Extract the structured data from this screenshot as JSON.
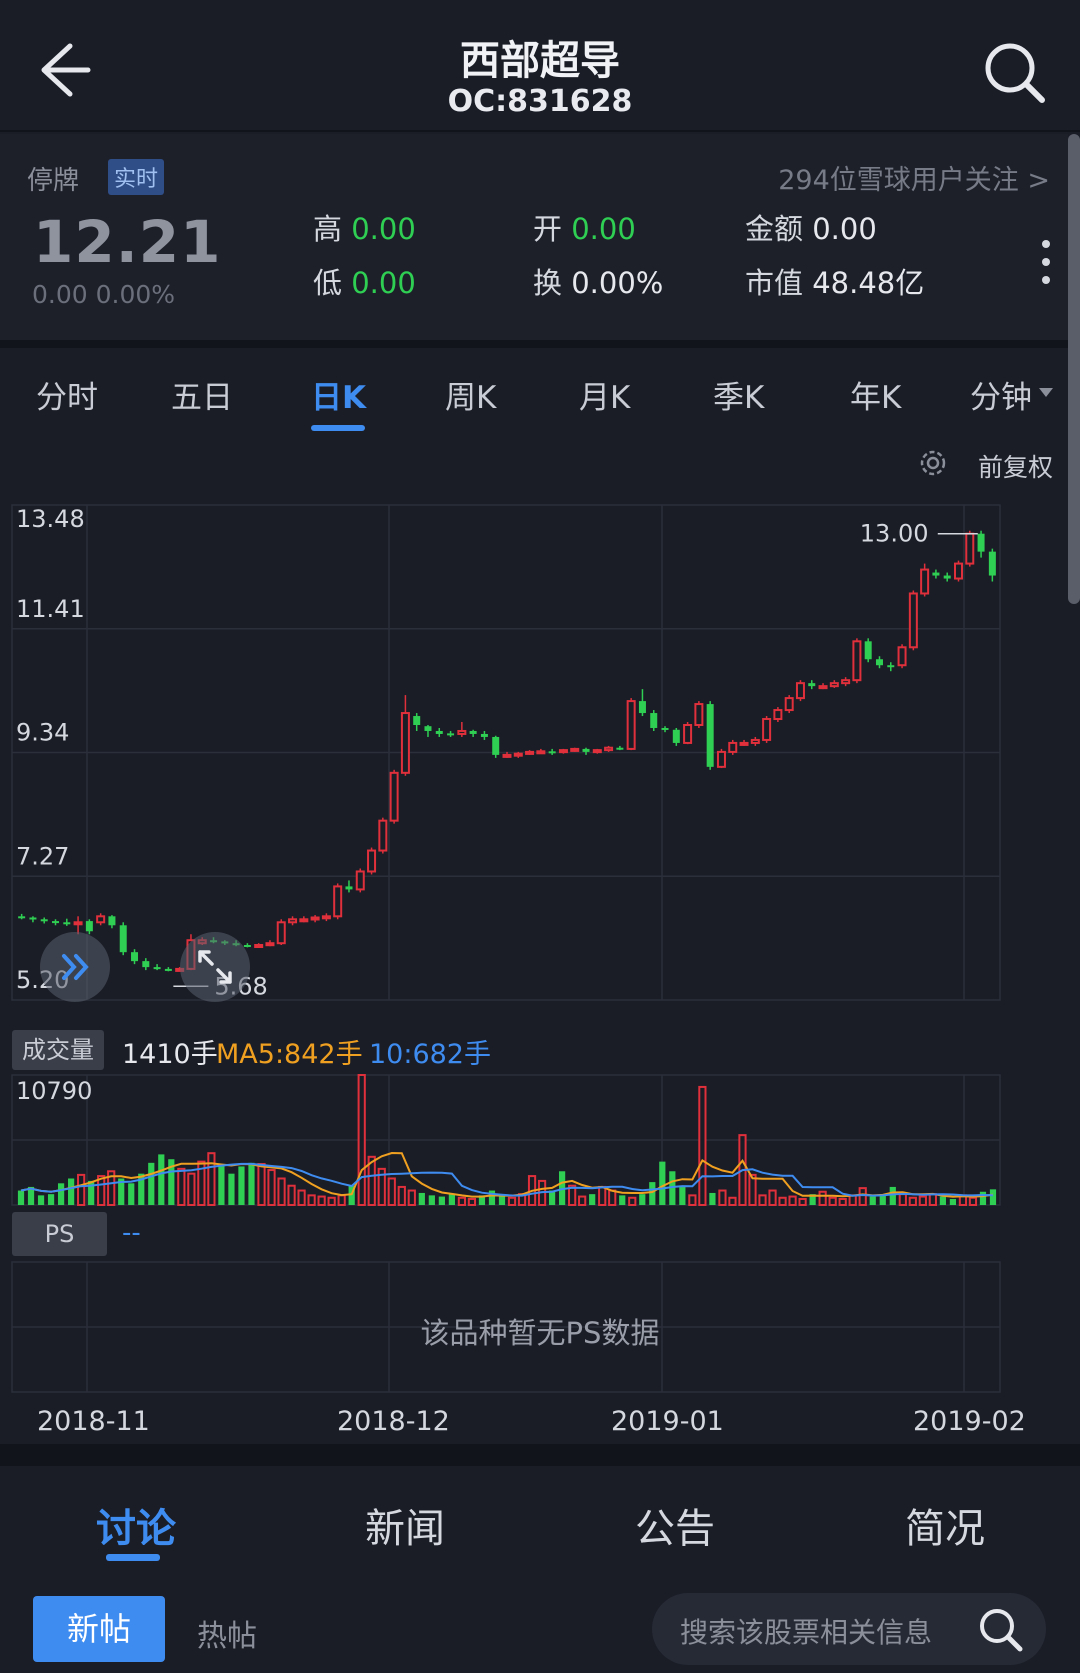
{
  "header": {
    "title": "西部超导",
    "code": "OC:831628"
  },
  "quote": {
    "status": "停牌",
    "badge": "实时",
    "followers": "294位雪球用户关注 >",
    "price": "12.21",
    "change": "0.00  0.00%",
    "high_label": "高",
    "high": "0.00",
    "low_label": "低",
    "low": "0.00",
    "open_label": "开",
    "open": "0.00",
    "turnover_label": "换",
    "turnover": "0.00%",
    "amount_label": "金额",
    "amount": "0.00",
    "mktcap_label": "市值",
    "mktcap": "48.48亿"
  },
  "tabs": [
    "分时",
    "五日",
    "日K",
    "周K",
    "月K",
    "季K",
    "年K",
    "分钟"
  ],
  "active_tab": "日K",
  "adjust_label": "前复权",
  "colors": {
    "up": "#e0303c",
    "down": "#2fcf53",
    "accent": "#3f8cf0",
    "ma5": "#f0a020",
    "ma10": "#3f8cf0"
  },
  "chart_data": {
    "type": "candlestick",
    "price_axis_labels": [
      "13.48",
      "11.41",
      "9.34",
      "7.27",
      "5.20"
    ],
    "ylim": [
      5.2,
      13.48
    ],
    "max_marker": "13.00",
    "min_marker": "5.68",
    "x_ticks": [
      "2018-11",
      "2018-12",
      "2019-01",
      "2019-02"
    ],
    "candles": [
      [
        6.6,
        6.58,
        6.64,
        6.55
      ],
      [
        6.58,
        6.55,
        6.6,
        6.5
      ],
      [
        6.55,
        6.52,
        6.58,
        6.48
      ],
      [
        6.52,
        6.5,
        6.55,
        6.45
      ],
      [
        6.5,
        6.48,
        6.56,
        6.44
      ],
      [
        6.48,
        6.5,
        6.6,
        6.3
      ],
      [
        6.52,
        6.35,
        6.55,
        6.3
      ],
      [
        6.5,
        6.6,
        6.65,
        6.45
      ],
      [
        6.6,
        6.45,
        6.62,
        6.4
      ],
      [
        6.45,
        6.0,
        6.5,
        5.95
      ],
      [
        6.0,
        5.85,
        6.05,
        5.8
      ],
      [
        5.85,
        5.75,
        5.9,
        5.7
      ],
      [
        5.75,
        5.72,
        5.8,
        5.7
      ],
      [
        5.72,
        5.7,
        5.75,
        5.68
      ],
      [
        5.7,
        5.72,
        5.75,
        5.68
      ],
      [
        5.72,
        6.2,
        6.3,
        5.7
      ],
      [
        6.15,
        6.2,
        6.25,
        6.12
      ],
      [
        6.2,
        6.18,
        6.25,
        6.15
      ],
      [
        6.18,
        6.15,
        6.2,
        6.12
      ],
      [
        6.15,
        6.12,
        6.2,
        6.1
      ],
      [
        6.12,
        6.1,
        6.15,
        6.08
      ],
      [
        6.1,
        6.12,
        6.15,
        6.08
      ],
      [
        6.12,
        6.15,
        6.2,
        6.1
      ],
      [
        6.15,
        6.5,
        6.55,
        6.12
      ],
      [
        6.5,
        6.55,
        6.6,
        6.45
      ],
      [
        6.55,
        6.55,
        6.6,
        6.5
      ],
      [
        6.55,
        6.58,
        6.62,
        6.5
      ],
      [
        6.58,
        6.6,
        6.65,
        6.52
      ],
      [
        6.6,
        7.1,
        7.15,
        6.55
      ],
      [
        7.1,
        7.05,
        7.2,
        7.0
      ],
      [
        7.05,
        7.35,
        7.4,
        7.0
      ],
      [
        7.35,
        7.7,
        7.75,
        7.3
      ],
      [
        7.7,
        8.2,
        8.25,
        7.65
      ],
      [
        8.2,
        9.0,
        9.05,
        8.15
      ],
      [
        9.0,
        10.0,
        10.3,
        8.95
      ],
      [
        9.95,
        9.8,
        10.0,
        9.7
      ],
      [
        9.78,
        9.7,
        9.8,
        9.6
      ],
      [
        9.7,
        9.65,
        9.75,
        9.6
      ],
      [
        9.66,
        9.65,
        9.7,
        9.6
      ],
      [
        9.65,
        9.7,
        9.85,
        9.6
      ],
      [
        9.7,
        9.65,
        9.72,
        9.6
      ],
      [
        9.65,
        9.6,
        9.7,
        9.55
      ],
      [
        9.6,
        9.3,
        9.62,
        9.25
      ],
      [
        9.3,
        9.3,
        9.35,
        9.25
      ],
      [
        9.3,
        9.32,
        9.35,
        9.25
      ],
      [
        9.32,
        9.35,
        9.38,
        9.3
      ],
      [
        9.35,
        9.36,
        9.4,
        9.32
      ],
      [
        9.36,
        9.35,
        9.4,
        9.3
      ],
      [
        9.35,
        9.38,
        9.4,
        9.32
      ],
      [
        9.38,
        9.4,
        9.42,
        9.35
      ],
      [
        9.4,
        9.35,
        9.42,
        9.3
      ],
      [
        9.35,
        9.38,
        9.4,
        9.32
      ],
      [
        9.38,
        9.42,
        9.45,
        9.35
      ],
      [
        9.42,
        9.4,
        9.45,
        9.38
      ],
      [
        9.4,
        10.2,
        10.25,
        9.38
      ],
      [
        10.2,
        10.0,
        10.4,
        9.95
      ],
      [
        10.0,
        9.75,
        10.05,
        9.7
      ],
      [
        9.75,
        9.72,
        9.78,
        9.68
      ],
      [
        9.72,
        9.5,
        9.75,
        9.45
      ],
      [
        9.5,
        9.8,
        9.85,
        9.48
      ],
      [
        9.8,
        10.15,
        10.2,
        9.75
      ],
      [
        10.15,
        9.1,
        10.2,
        9.05
      ],
      [
        9.1,
        9.35,
        9.4,
        9.08
      ],
      [
        9.35,
        9.5,
        9.55,
        9.3
      ],
      [
        9.5,
        9.5,
        9.55,
        9.45
      ],
      [
        9.5,
        9.55,
        9.6,
        9.45
      ],
      [
        9.55,
        9.9,
        9.95,
        9.5
      ],
      [
        9.9,
        10.05,
        10.1,
        9.85
      ],
      [
        10.05,
        10.25,
        10.3,
        10.0
      ],
      [
        10.25,
        10.5,
        10.55,
        10.2
      ],
      [
        10.5,
        10.45,
        10.55,
        10.4
      ],
      [
        10.45,
        10.45,
        10.5,
        10.4
      ],
      [
        10.45,
        10.5,
        10.55,
        10.42
      ],
      [
        10.5,
        10.55,
        10.6,
        10.45
      ],
      [
        10.55,
        11.2,
        11.25,
        10.5
      ],
      [
        11.2,
        10.9,
        11.25,
        10.85
      ],
      [
        10.9,
        10.8,
        10.95,
        10.75
      ],
      [
        10.8,
        10.78,
        10.85,
        10.7
      ],
      [
        10.8,
        11.1,
        11.15,
        10.75
      ],
      [
        11.1,
        12.0,
        12.05,
        11.05
      ],
      [
        12.0,
        12.4,
        12.5,
        11.95
      ],
      [
        12.35,
        12.3,
        12.4,
        12.25
      ],
      [
        12.3,
        12.25,
        12.35,
        12.2
      ],
      [
        12.25,
        12.5,
        12.55,
        12.2
      ],
      [
        12.5,
        13.0,
        13.05,
        12.45
      ],
      [
        13.0,
        12.7,
        13.05,
        12.6
      ],
      [
        12.7,
        12.3,
        12.75,
        12.2
      ]
    ],
    "volume_label": "成交量",
    "volume_text": "1410手",
    "ma5_text": "MA5:842手",
    "ma10_text": "10:682手",
    "volume_axis_max": "10790",
    "volumes": [
      1200,
      1500,
      800,
      900,
      1800,
      2200,
      2500,
      2000,
      2400,
      2800,
      2200,
      1800,
      2600,
      3500,
      4200,
      3800,
      3000,
      2600,
      3600,
      4300,
      3300,
      2600,
      3200,
      3500,
      3400,
      2900,
      2200,
      1600,
      1200,
      800,
      700,
      600,
      800,
      1600,
      10790,
      4000,
      3000,
      2200,
      1500,
      1200,
      1000,
      800,
      700,
      900,
      600,
      500,
      800,
      1200,
      800,
      600,
      900,
      2400,
      2000,
      1200,
      2800,
      1600,
      700,
      900,
      1500,
      1200,
      800,
      600,
      900,
      1900,
      3600,
      2800,
      1500,
      800,
      9800,
      1000,
      1200,
      600,
      5800,
      2500,
      800,
      1200,
      600,
      700,
      500,
      900,
      1100,
      600,
      500,
      800,
      1400,
      700,
      800,
      1500,
      900,
      600,
      700,
      900,
      700,
      500,
      800,
      600,
      1100,
      1300
    ],
    "ps_label": "PS",
    "ps_value": "--",
    "ps_empty": "该品种暂无PS数据"
  },
  "bottom_tabs": [
    "讨论",
    "新闻",
    "公告",
    "简况"
  ],
  "active_bottom_tab": "讨论",
  "post_tabs": {
    "new": "新帖",
    "hot": "热帖"
  },
  "search_placeholder": "搜索该股票相关信息"
}
